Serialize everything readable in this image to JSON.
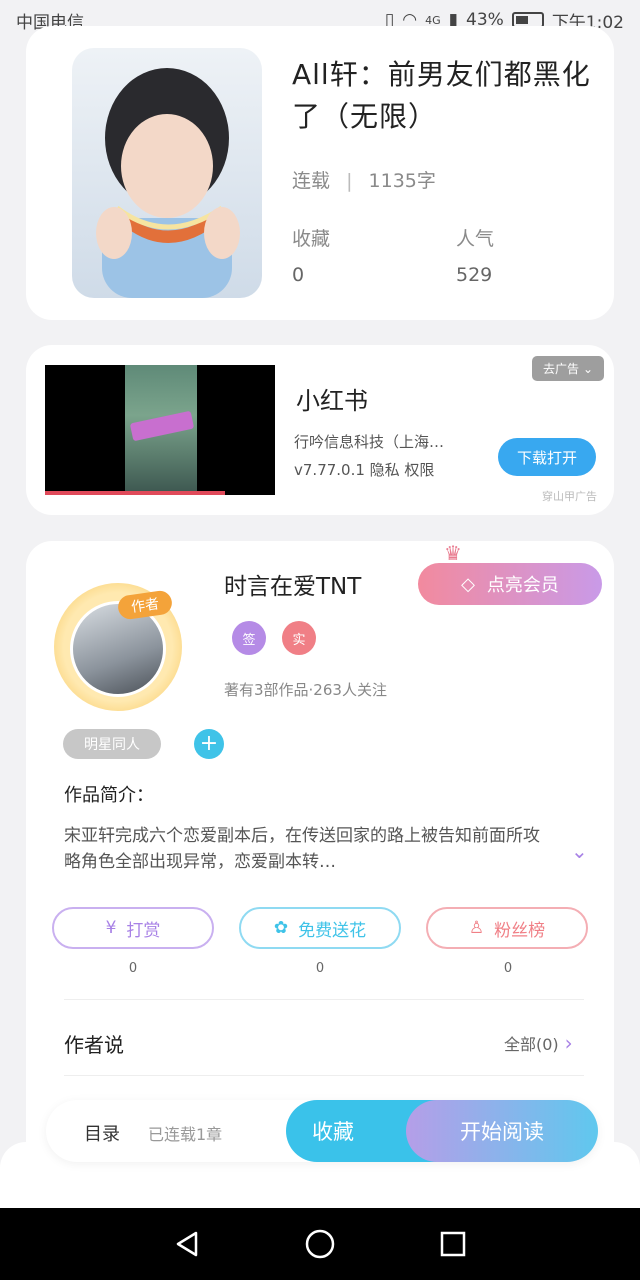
{
  "status_bar": {
    "carrier": "中国电信",
    "network": "4G",
    "battery": "43%",
    "time": "下午1:02"
  },
  "book": {
    "title": "All轩：前男友们都黑化了（无限）",
    "status": "连载",
    "word_count": "1135字",
    "favorites_label": "收藏",
    "favorites_value": "0",
    "popularity_label": "人气",
    "popularity_value": "529",
    "cover_icon": "book-cover-image"
  },
  "ad": {
    "name": "小红书",
    "company": "行吟信息科技（上海…",
    "version_info": "v7.77.0.1 隐私 权限",
    "button": "下载打开",
    "close_label": "去广告",
    "source": "穿山甲广告",
    "accent": "#38a8f0"
  },
  "author": {
    "name": "时言在爱TNT",
    "tag": "作者",
    "vip_button": "点亮会员",
    "badges": [
      {
        "label": "签",
        "color": "#b58be6"
      },
      {
        "label": "实",
        "color": "#f07f86"
      }
    ],
    "stats": "著有3部作品·263人关注",
    "genre_tag": "明星同人",
    "intro_label": "作品简介：",
    "intro_text": "宋亚轩完成六个恋爱副本后，在传送回家的路上被告知前面所攻略角色全部出现异常，恋爱副本转…",
    "actions": [
      {
        "label": "打赏",
        "icon": "yen-icon",
        "color": "#b58be6",
        "count": "0"
      },
      {
        "label": "免费送花",
        "icon": "flower-icon",
        "color": "#3fc3e8",
        "count": "0"
      },
      {
        "label": "粉丝榜",
        "icon": "user-icon",
        "color": "#f07f86",
        "count": "0"
      }
    ],
    "say_label": "作者说",
    "say_all": "全部(0)"
  },
  "bottom_bar": {
    "toc_label": "目录",
    "toc_status": "已连载1章",
    "collect": "收藏",
    "read": "开始阅读"
  }
}
